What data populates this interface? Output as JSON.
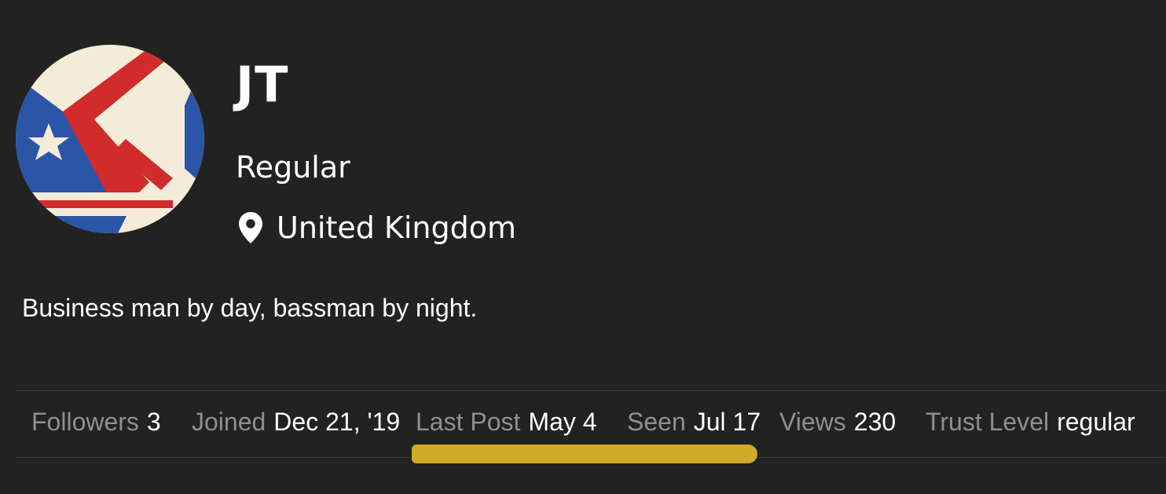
{
  "profile": {
    "username": "JT",
    "title": "Regular",
    "location": "United Kingdom",
    "bio": "Business man by day, bassman by night."
  },
  "stats": [
    {
      "label": "Followers",
      "value": "3"
    },
    {
      "label": "Joined",
      "value": "Dec 21, '19"
    },
    {
      "label": "Last Post",
      "value": "May 4"
    },
    {
      "label": "Seen",
      "value": "Jul 17"
    },
    {
      "label": "Views",
      "value": "230"
    },
    {
      "label": "Trust Level",
      "value": "regular"
    }
  ],
  "icons": {
    "location": "map-pin-icon"
  },
  "colors": {
    "background": "#222222",
    "text": "#ffffff",
    "muted": "#8f8f8f",
    "highlight": "#d8b42a",
    "flag_blue": "#2b56a8",
    "flag_red": "#d12b2b",
    "flag_cream": "#f4ecd8"
  }
}
